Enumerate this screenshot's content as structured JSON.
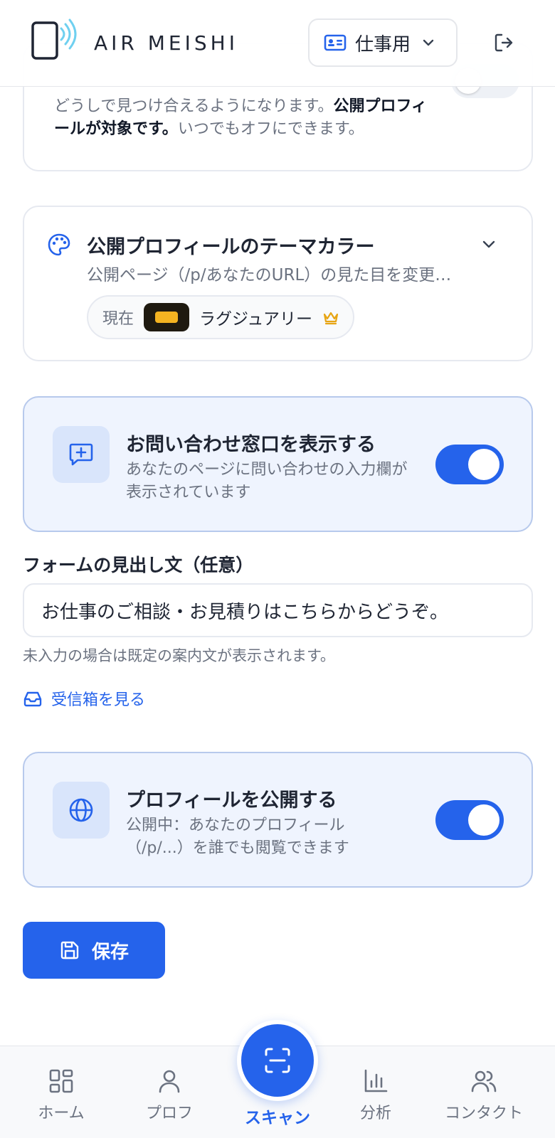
{
  "header": {
    "app_name": "AIR MEISHI",
    "mode_select": {
      "selected": "仕事用",
      "icon": "id-card-icon"
    },
    "logout_icon": "logout-icon"
  },
  "partial_card": {
    "text_before": "どうしで見つけ合えるようになります。",
    "text_bold": "公開プロフィールが対象です。",
    "text_after": "いつでもオフにできます。"
  },
  "theme": {
    "title": "公開プロフィールのテーマカラー",
    "subtitle": "公開ページ（/p/あなたのURL）の見た目を変更…",
    "current_label": "現在",
    "current_name": "ラグジュアリー",
    "swatch_colors": {
      "outer": "#1f1a10",
      "inner": "#f4b321"
    }
  },
  "contact_form": {
    "title": "お問い合わせ窓口を表示する",
    "description": "あなたのページに問い合わせの入力欄が表示されています",
    "enabled": true
  },
  "form_heading": {
    "label": "フォームの見出し文（任意）",
    "value": "お仕事のご相談・お見積りはこちらからどうぞ。",
    "hint": "未入力の場合は既定の案内文が表示されます。"
  },
  "inbox_link": {
    "label": "受信箱を見る"
  },
  "publish": {
    "title": "プロフィールを公開する",
    "description": "公開中：あなたのプロフィール（/p/...）を誰でも閲覧できます",
    "enabled": true
  },
  "save_button": {
    "label": "保存"
  },
  "bottom_nav": {
    "home": "ホーム",
    "profile": "プロフ",
    "scan": "スキャン",
    "analytics": "分析",
    "contacts": "コンタクト"
  },
  "colors": {
    "accent": "#2563eb",
    "card_blue_bg": "#eff4fe",
    "muted_text": "#6b7280"
  }
}
